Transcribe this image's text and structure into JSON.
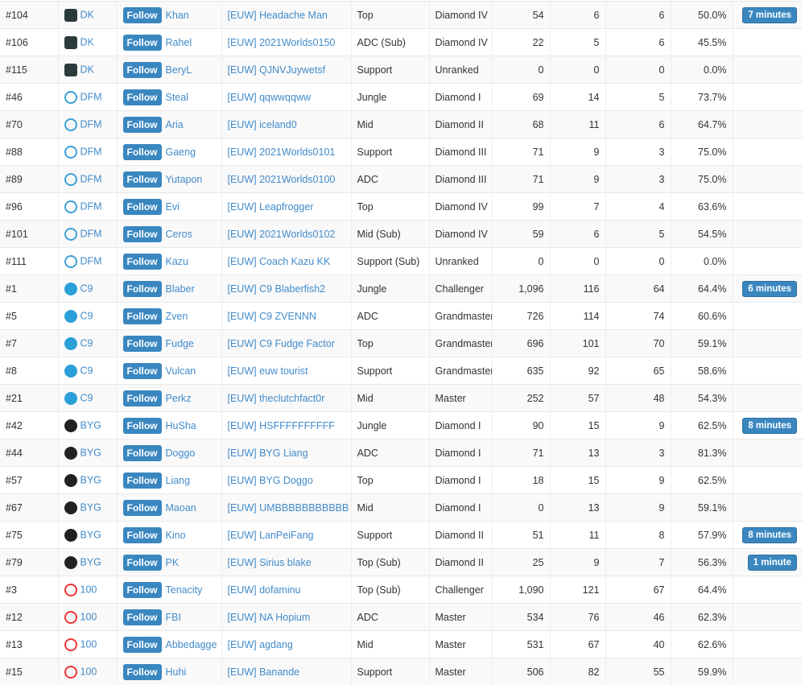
{
  "follow_label": "Follow",
  "teams": {
    "DK": {
      "icon": "dk-logo-icon",
      "color": "#2b3b3b"
    },
    "DFM": {
      "icon": "dfm-logo-icon",
      "color": "#3aa0d8"
    },
    "C9": {
      "icon": "c9-logo-icon",
      "color": "#2a9fd8"
    },
    "BYG": {
      "icon": "byg-logo-icon",
      "color": "#222"
    },
    "100": {
      "icon": "100-thieves-logo-icon",
      "color": "#e33"
    }
  },
  "rows": [
    [
      "#104",
      "DK",
      "Khan",
      "[EUW] Headache Man",
      "Top",
      "Diamond IV",
      "54",
      "6",
      "6",
      "50.0%",
      "7 minutes"
    ],
    [
      "#106",
      "DK",
      "Rahel",
      "[EUW] 2021Worlds0150",
      "ADC (Sub)",
      "Diamond IV",
      "22",
      "5",
      "6",
      "45.5%",
      ""
    ],
    [
      "#115",
      "DK",
      "BeryL",
      "[EUW] QJNVJuywetsf",
      "Support",
      "Unranked",
      "0",
      "0",
      "0",
      "0.0%",
      ""
    ],
    [
      "#46",
      "DFM",
      "Steal",
      "[EUW] qqwwqqww",
      "Jungle",
      "Diamond I",
      "69",
      "14",
      "5",
      "73.7%",
      ""
    ],
    [
      "#70",
      "DFM",
      "Aria",
      "[EUW] iceland0",
      "Mid",
      "Diamond II",
      "68",
      "11",
      "6",
      "64.7%",
      ""
    ],
    [
      "#88",
      "DFM",
      "Gaeng",
      "[EUW] 2021Worlds0101",
      "Support",
      "Diamond III",
      "71",
      "9",
      "3",
      "75.0%",
      ""
    ],
    [
      "#89",
      "DFM",
      "Yutapon",
      "[EUW] 2021Worlds0100",
      "ADC",
      "Diamond III",
      "71",
      "9",
      "3",
      "75.0%",
      ""
    ],
    [
      "#96",
      "DFM",
      "Evi",
      "[EUW] Leapfrogger",
      "Top",
      "Diamond IV",
      "99",
      "7",
      "4",
      "63.6%",
      ""
    ],
    [
      "#101",
      "DFM",
      "Ceros",
      "[EUW] 2021Worlds0102",
      "Mid (Sub)",
      "Diamond IV",
      "59",
      "6",
      "5",
      "54.5%",
      ""
    ],
    [
      "#111",
      "DFM",
      "Kazu",
      "[EUW] Coach Kazu KK",
      "Support (Sub)",
      "Unranked",
      "0",
      "0",
      "0",
      "0.0%",
      ""
    ],
    [
      "#1",
      "C9",
      "Blaber",
      "[EUW] C9 Blaberfish2",
      "Jungle",
      "Challenger",
      "1,096",
      "116",
      "64",
      "64.4%",
      "6 minutes"
    ],
    [
      "#5",
      "C9",
      "Zven",
      "[EUW] C9 ZVENNN",
      "ADC",
      "Grandmaster",
      "726",
      "114",
      "74",
      "60.6%",
      ""
    ],
    [
      "#7",
      "C9",
      "Fudge",
      "[EUW] C9 Fudge Factor",
      "Top",
      "Grandmaster",
      "696",
      "101",
      "70",
      "59.1%",
      ""
    ],
    [
      "#8",
      "C9",
      "Vulcan",
      "[EUW] euw tourist",
      "Support",
      "Grandmaster",
      "635",
      "92",
      "65",
      "58.6%",
      ""
    ],
    [
      "#21",
      "C9",
      "Perkz",
      "[EUW] theclutchfact0r",
      "Mid",
      "Master",
      "252",
      "57",
      "48",
      "54.3%",
      ""
    ],
    [
      "#42",
      "BYG",
      "HuSha",
      "[EUW] HSFFFFFFFFFF",
      "Jungle",
      "Diamond I",
      "90",
      "15",
      "9",
      "62.5%",
      "8 minutes"
    ],
    [
      "#44",
      "BYG",
      "Doggo",
      "[EUW] BYG Liang",
      "ADC",
      "Diamond I",
      "71",
      "13",
      "3",
      "81.3%",
      ""
    ],
    [
      "#57",
      "BYG",
      "Liang",
      "[EUW] BYG Doggo",
      "Top",
      "Diamond I",
      "18",
      "15",
      "9",
      "62.5%",
      ""
    ],
    [
      "#67",
      "BYG",
      "Maoan",
      "[EUW] UMBBBBBBBBBBB",
      "Mid",
      "Diamond I",
      "0",
      "13",
      "9",
      "59.1%",
      ""
    ],
    [
      "#75",
      "BYG",
      "Kino",
      "[EUW] LanPeiFang",
      "Support",
      "Diamond II",
      "51",
      "11",
      "8",
      "57.9%",
      "8 minutes"
    ],
    [
      "#79",
      "BYG",
      "PK",
      "[EUW] Sirius blake",
      "Top (Sub)",
      "Diamond II",
      "25",
      "9",
      "7",
      "56.3%",
      "1 minute"
    ],
    [
      "#3",
      "100",
      "Tenacity",
      "[EUW] dofaminu",
      "Top (Sub)",
      "Challenger",
      "1,090",
      "121",
      "67",
      "64.4%",
      ""
    ],
    [
      "#12",
      "100",
      "FBI",
      "[EUW] NA Hopium",
      "ADC",
      "Master",
      "534",
      "76",
      "46",
      "62.3%",
      ""
    ],
    [
      "#13",
      "100",
      "Abbedagge",
      "[EUW] agdang",
      "Mid",
      "Master",
      "531",
      "67",
      "40",
      "62.6%",
      ""
    ],
    [
      "#15",
      "100",
      "Huhi",
      "[EUW] Banande",
      "Support",
      "Master",
      "506",
      "82",
      "55",
      "59.9%",
      ""
    ]
  ]
}
